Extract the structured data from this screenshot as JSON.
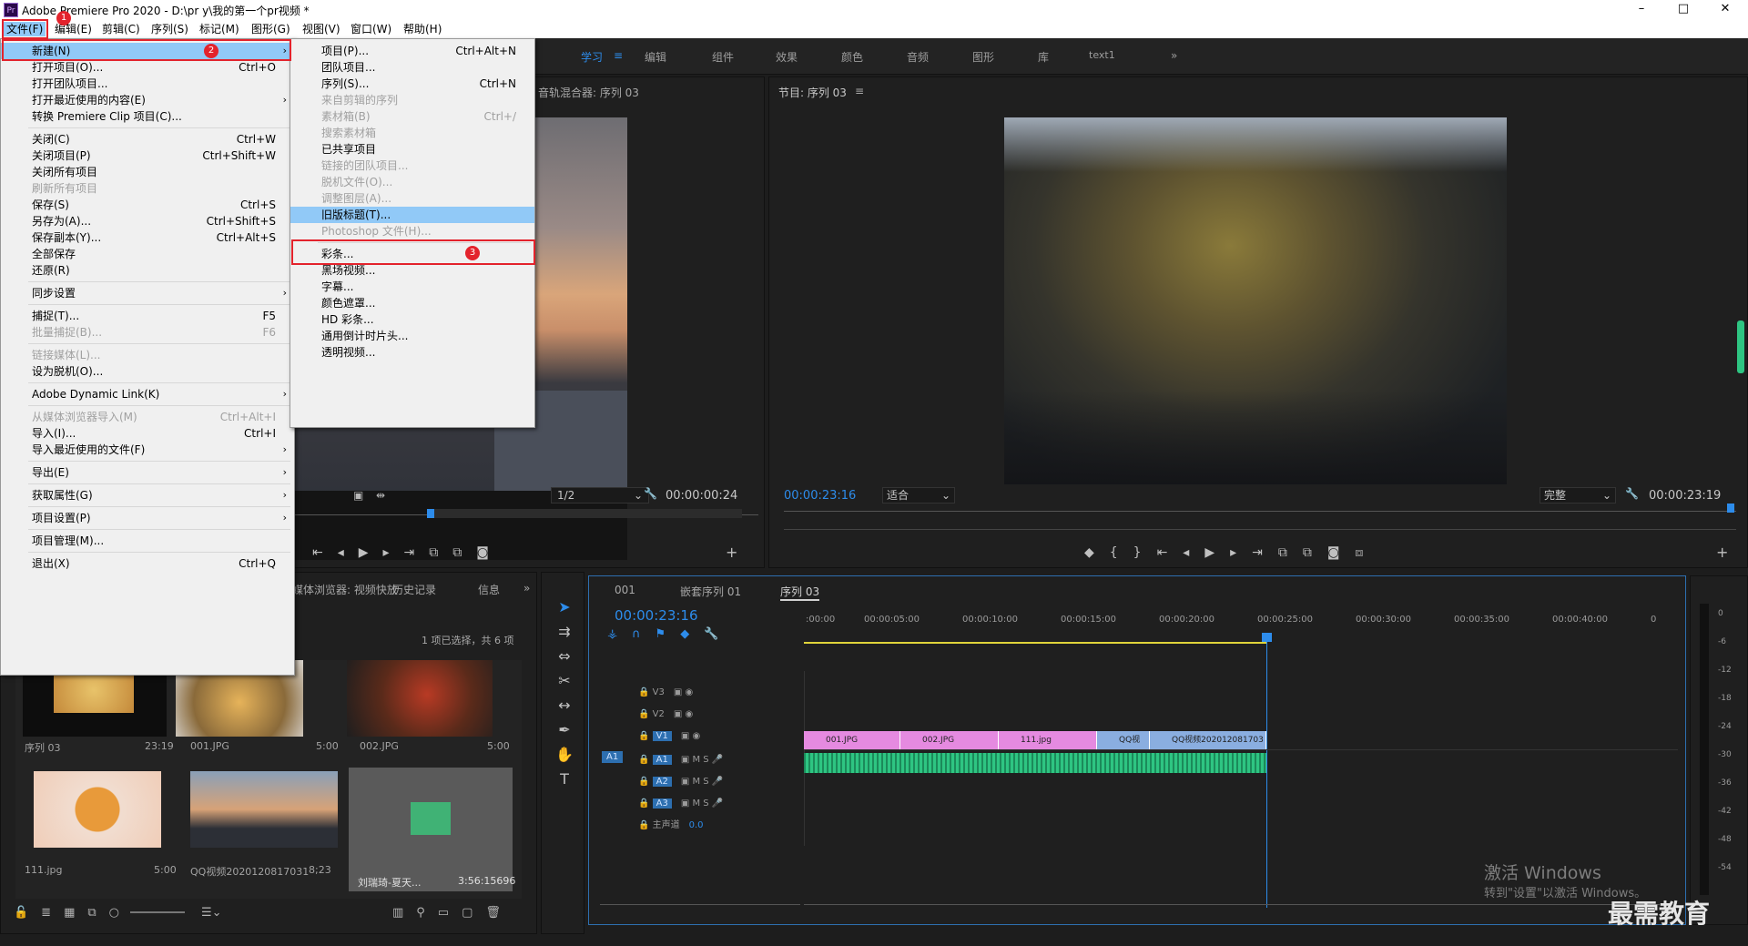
{
  "window": {
    "title": "Adobe Premiere Pro 2020 - D:\\pr y\\我的第一个pr视频 *",
    "app_icon": "Pr",
    "controls": [
      "–",
      "□",
      "✕"
    ]
  },
  "menubar": [
    "文件(F)",
    "编辑(E)",
    "剪辑(C)",
    "序列(S)",
    "标记(M)",
    "图形(G)",
    "视图(V)",
    "窗口(W)",
    "帮助(H)"
  ],
  "workspaces": [
    "学习",
    "编辑",
    "组件",
    "效果",
    "颜色",
    "音频",
    "图形",
    "库",
    "text1"
  ],
  "file_menu": [
    {
      "label": "新建(N)",
      "arrow": true,
      "hl": true
    },
    {
      "label": "打开项目(O)...",
      "sc": "Ctrl+O"
    },
    {
      "label": "打开团队项目..."
    },
    {
      "label": "打开最近使用的内容(E)",
      "arrow": true
    },
    {
      "label": "转换 Premiere Clip 项目(C)..."
    },
    {
      "sep": true
    },
    {
      "label": "关闭(C)",
      "sc": "Ctrl+W"
    },
    {
      "label": "关闭项目(P)",
      "sc": "Ctrl+Shift+W"
    },
    {
      "label": "关闭所有项目"
    },
    {
      "label": "刷新所有项目",
      "dis": true
    },
    {
      "label": "保存(S)",
      "sc": "Ctrl+S"
    },
    {
      "label": "另存为(A)...",
      "sc": "Ctrl+Shift+S"
    },
    {
      "label": "保存副本(Y)...",
      "sc": "Ctrl+Alt+S"
    },
    {
      "label": "全部保存"
    },
    {
      "label": "还原(R)"
    },
    {
      "sep": true
    },
    {
      "label": "同步设置",
      "arrow": true
    },
    {
      "sep": true
    },
    {
      "label": "捕捉(T)...",
      "sc": "F5"
    },
    {
      "label": "批量捕捉(B)...",
      "sc": "F6",
      "dis": true
    },
    {
      "sep": true
    },
    {
      "label": "链接媒体(L)...",
      "dis": true
    },
    {
      "label": "设为脱机(O)..."
    },
    {
      "sep": true
    },
    {
      "label": "Adobe Dynamic Link(K)",
      "arrow": true
    },
    {
      "sep": true
    },
    {
      "label": "从媒体浏览器导入(M)",
      "sc": "Ctrl+Alt+I",
      "dis": true
    },
    {
      "label": "导入(I)...",
      "sc": "Ctrl+I"
    },
    {
      "label": "导入最近使用的文件(F)",
      "arrow": true
    },
    {
      "sep": true
    },
    {
      "label": "导出(E)",
      "arrow": true
    },
    {
      "sep": true
    },
    {
      "label": "获取属性(G)",
      "arrow": true
    },
    {
      "sep": true
    },
    {
      "label": "项目设置(P)",
      "arrow": true
    },
    {
      "sep": true
    },
    {
      "label": "项目管理(M)..."
    },
    {
      "sep": true
    },
    {
      "label": "退出(X)",
      "sc": "Ctrl+Q"
    }
  ],
  "new_menu": [
    {
      "label": "项目(P)...",
      "sc": "Ctrl+Alt+N"
    },
    {
      "label": "团队项目..."
    },
    {
      "label": "序列(S)...",
      "sc": "Ctrl+N"
    },
    {
      "label": "来自剪辑的序列",
      "dis": true
    },
    {
      "label": "素材箱(B)",
      "sc": "Ctrl+/",
      "dis": true
    },
    {
      "label": "搜索素材箱",
      "dis": true
    },
    {
      "label": "已共享项目"
    },
    {
      "label": "链接的团队项目...",
      "dis": true
    },
    {
      "label": "脱机文件(O)...",
      "dis": true
    },
    {
      "label": "调整图层(A)...",
      "dis": true
    },
    {
      "label": "旧版标题(T)...",
      "hl": true
    },
    {
      "label": "Photoshop 文件(H)...",
      "dis": true
    },
    {
      "sep": true
    },
    {
      "label": "彩条..."
    },
    {
      "label": "黑场视频..."
    },
    {
      "label": "字幕..."
    },
    {
      "label": "颜色遮罩..."
    },
    {
      "label": "HD 彩条..."
    },
    {
      "label": "通用倒计时片头..."
    },
    {
      "label": "透明视频..."
    }
  ],
  "badges": [
    "1",
    "2",
    "3"
  ],
  "source": {
    "tab": "音轨混合器: 序列 03",
    "ratio": "1/2",
    "tc": "00:00:00:24"
  },
  "program": {
    "tab": "节目: 序列 03",
    "tc_left": "00:00:23:16",
    "fit": "适合",
    "quality": "完整",
    "tc_right": "00:00:23:19"
  },
  "project": {
    "tabs": [
      "媒体浏览器: 视频快放",
      "历史记录",
      "信息"
    ],
    "info": "1 项已选择，共 6 项",
    "items": [
      {
        "name": "序列 03",
        "dur": "23:19"
      },
      {
        "name": "001.JPG",
        "dur": "5:00"
      },
      {
        "name": "002.JPG",
        "dur": "5:00"
      },
      {
        "name": "111.jpg",
        "dur": "5:00"
      },
      {
        "name": "QQ视频20201208170313...",
        "dur": "8;23"
      },
      {
        "name": "刘瑞琦-夏天...",
        "dur": "3:56:15696"
      }
    ]
  },
  "timeline": {
    "tabs": [
      "001",
      "嵌套序列 01",
      "序列 03"
    ],
    "tc": "00:00:23:16",
    "ruler": [
      ":00:00",
      "00:00:05:00",
      "00:00:10:00",
      "00:00:15:00",
      "00:00:20:00",
      "00:00:25:00",
      "00:00:30:00",
      "00:00:35:00",
      "00:00:40:00",
      "0"
    ],
    "tracks": [
      "V3",
      "V2",
      "V1",
      "A1",
      "A2",
      "A3"
    ],
    "master": "主声道",
    "master_val": "0.0",
    "clips": [
      "001.JPG",
      "002.JPG",
      "111.jpg",
      "QQ视",
      "QQ视频202012081703"
    ],
    "src_patch": "A1"
  },
  "meter": [
    "0",
    "-6",
    "-12",
    "-18",
    "-24",
    "-30",
    "-36",
    "-42",
    "-48",
    "-54"
  ],
  "watermark": {
    "line1": "激活 Windows",
    "line2": "转到\"设置\"以激活 Windows。",
    "brand": "最需教育"
  }
}
